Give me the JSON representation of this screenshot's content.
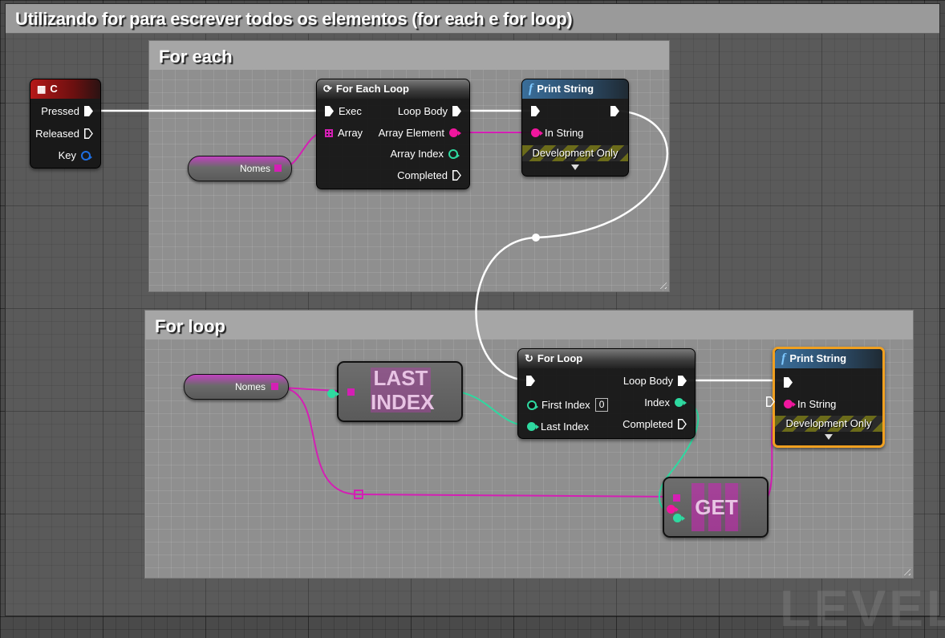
{
  "outer_comment": {
    "title": "Utilizando for para escrever todos os elementos (for each e for loop)"
  },
  "for_each_comment": {
    "title": "For each"
  },
  "for_loop_comment": {
    "title": "For loop"
  },
  "key_event": {
    "title": "C",
    "icon": "keyboard-icon",
    "pins": {
      "pressed": "Pressed",
      "released": "Released",
      "key": "Key"
    }
  },
  "nomes_var_1": {
    "label": "Nomes"
  },
  "nomes_var_2": {
    "label": "Nomes"
  },
  "for_each_loop": {
    "title": "For Each Loop",
    "icon": "loop-icon",
    "pins": {
      "exec": "Exec",
      "array": "Array",
      "loop_body": "Loop Body",
      "array_element": "Array Element",
      "array_index": "Array Index",
      "completed": "Completed"
    }
  },
  "print_string_1": {
    "title": "Print String",
    "icon": "function-icon",
    "in_string": "In String",
    "dev_only": "Development Only"
  },
  "last_index_node": {
    "line1": "LAST",
    "line2": "INDEX"
  },
  "for_loop": {
    "title": "For Loop",
    "icon": "loop-icon",
    "pins": {
      "loop_body": "Loop Body",
      "first_index": "First Index",
      "first_index_value": "0",
      "last_index": "Last Index",
      "index": "Index",
      "completed": "Completed"
    }
  },
  "print_string_2": {
    "title": "Print String",
    "icon": "function-icon",
    "in_string": "In String",
    "dev_only": "Development Only",
    "selected": true
  },
  "get_node": {
    "label": "GET"
  },
  "watermark": "LEVEL",
  "colors": {
    "exec": "#ffffff",
    "string_pin": "#f0169e",
    "integer_pin": "#2ed9a0",
    "array_pin": "#d41fb4",
    "struct_pin": "#1e6ee0",
    "selection": "#f0a020",
    "event_header": "#b51818",
    "function_header": "#3a6e9a"
  }
}
